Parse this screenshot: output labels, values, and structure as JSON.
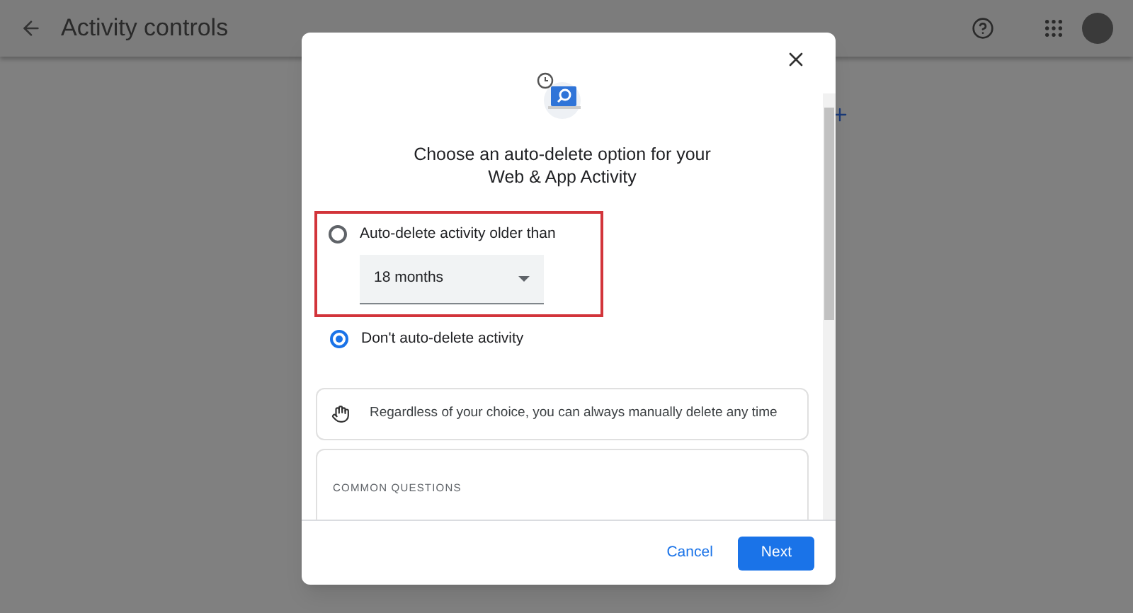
{
  "app_bar": {
    "title": "Activity controls"
  },
  "dialog": {
    "heading_lines": [
      "Choose an auto-delete option for your",
      "Web & App Activity"
    ],
    "options": [
      {
        "kind": "dropdown",
        "label": "Auto-delete activity older than",
        "selected": false,
        "value": "18 months",
        "highlighted": true
      },
      {
        "kind": "plain",
        "label": "Don't auto-delete activity",
        "selected": true,
        "highlighted": false
      }
    ],
    "info": "Regardless of your choice, you can always manually delete any time",
    "section_title": "COMMON QUESTIONS",
    "buttons": [
      {
        "kind": "text",
        "label": "Cancel"
      },
      {
        "kind": "filled",
        "label": "Next"
      }
    ]
  }
}
